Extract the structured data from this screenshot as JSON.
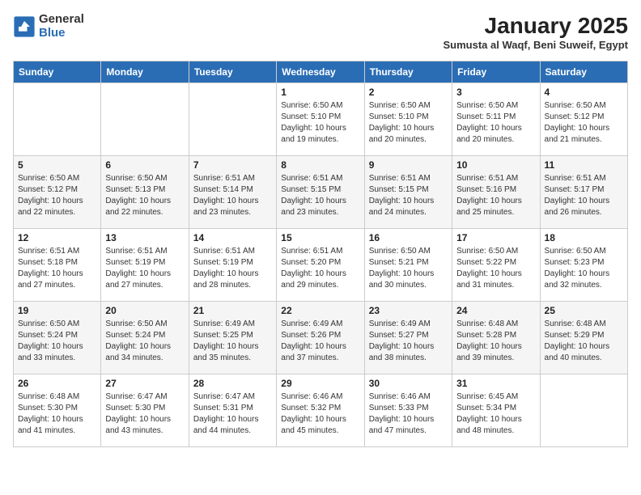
{
  "logo": {
    "general": "General",
    "blue": "Blue"
  },
  "title": "January 2025",
  "subtitle": "Sumusta al Waqf, Beni Suweif, Egypt",
  "headers": [
    "Sunday",
    "Monday",
    "Tuesday",
    "Wednesday",
    "Thursday",
    "Friday",
    "Saturday"
  ],
  "weeks": [
    [
      {
        "day": "",
        "info": ""
      },
      {
        "day": "",
        "info": ""
      },
      {
        "day": "",
        "info": ""
      },
      {
        "day": "1",
        "info": "Sunrise: 6:50 AM\nSunset: 5:10 PM\nDaylight: 10 hours\nand 19 minutes."
      },
      {
        "day": "2",
        "info": "Sunrise: 6:50 AM\nSunset: 5:10 PM\nDaylight: 10 hours\nand 20 minutes."
      },
      {
        "day": "3",
        "info": "Sunrise: 6:50 AM\nSunset: 5:11 PM\nDaylight: 10 hours\nand 20 minutes."
      },
      {
        "day": "4",
        "info": "Sunrise: 6:50 AM\nSunset: 5:12 PM\nDaylight: 10 hours\nand 21 minutes."
      }
    ],
    [
      {
        "day": "5",
        "info": "Sunrise: 6:50 AM\nSunset: 5:12 PM\nDaylight: 10 hours\nand 22 minutes."
      },
      {
        "day": "6",
        "info": "Sunrise: 6:50 AM\nSunset: 5:13 PM\nDaylight: 10 hours\nand 22 minutes."
      },
      {
        "day": "7",
        "info": "Sunrise: 6:51 AM\nSunset: 5:14 PM\nDaylight: 10 hours\nand 23 minutes."
      },
      {
        "day": "8",
        "info": "Sunrise: 6:51 AM\nSunset: 5:15 PM\nDaylight: 10 hours\nand 23 minutes."
      },
      {
        "day": "9",
        "info": "Sunrise: 6:51 AM\nSunset: 5:15 PM\nDaylight: 10 hours\nand 24 minutes."
      },
      {
        "day": "10",
        "info": "Sunrise: 6:51 AM\nSunset: 5:16 PM\nDaylight: 10 hours\nand 25 minutes."
      },
      {
        "day": "11",
        "info": "Sunrise: 6:51 AM\nSunset: 5:17 PM\nDaylight: 10 hours\nand 26 minutes."
      }
    ],
    [
      {
        "day": "12",
        "info": "Sunrise: 6:51 AM\nSunset: 5:18 PM\nDaylight: 10 hours\nand 27 minutes."
      },
      {
        "day": "13",
        "info": "Sunrise: 6:51 AM\nSunset: 5:19 PM\nDaylight: 10 hours\nand 27 minutes."
      },
      {
        "day": "14",
        "info": "Sunrise: 6:51 AM\nSunset: 5:19 PM\nDaylight: 10 hours\nand 28 minutes."
      },
      {
        "day": "15",
        "info": "Sunrise: 6:51 AM\nSunset: 5:20 PM\nDaylight: 10 hours\nand 29 minutes."
      },
      {
        "day": "16",
        "info": "Sunrise: 6:50 AM\nSunset: 5:21 PM\nDaylight: 10 hours\nand 30 minutes."
      },
      {
        "day": "17",
        "info": "Sunrise: 6:50 AM\nSunset: 5:22 PM\nDaylight: 10 hours\nand 31 minutes."
      },
      {
        "day": "18",
        "info": "Sunrise: 6:50 AM\nSunset: 5:23 PM\nDaylight: 10 hours\nand 32 minutes."
      }
    ],
    [
      {
        "day": "19",
        "info": "Sunrise: 6:50 AM\nSunset: 5:24 PM\nDaylight: 10 hours\nand 33 minutes."
      },
      {
        "day": "20",
        "info": "Sunrise: 6:50 AM\nSunset: 5:24 PM\nDaylight: 10 hours\nand 34 minutes."
      },
      {
        "day": "21",
        "info": "Sunrise: 6:49 AM\nSunset: 5:25 PM\nDaylight: 10 hours\nand 35 minutes."
      },
      {
        "day": "22",
        "info": "Sunrise: 6:49 AM\nSunset: 5:26 PM\nDaylight: 10 hours\nand 37 minutes."
      },
      {
        "day": "23",
        "info": "Sunrise: 6:49 AM\nSunset: 5:27 PM\nDaylight: 10 hours\nand 38 minutes."
      },
      {
        "day": "24",
        "info": "Sunrise: 6:48 AM\nSunset: 5:28 PM\nDaylight: 10 hours\nand 39 minutes."
      },
      {
        "day": "25",
        "info": "Sunrise: 6:48 AM\nSunset: 5:29 PM\nDaylight: 10 hours\nand 40 minutes."
      }
    ],
    [
      {
        "day": "26",
        "info": "Sunrise: 6:48 AM\nSunset: 5:30 PM\nDaylight: 10 hours\nand 41 minutes."
      },
      {
        "day": "27",
        "info": "Sunrise: 6:47 AM\nSunset: 5:30 PM\nDaylight: 10 hours\nand 43 minutes."
      },
      {
        "day": "28",
        "info": "Sunrise: 6:47 AM\nSunset: 5:31 PM\nDaylight: 10 hours\nand 44 minutes."
      },
      {
        "day": "29",
        "info": "Sunrise: 6:46 AM\nSunset: 5:32 PM\nDaylight: 10 hours\nand 45 minutes."
      },
      {
        "day": "30",
        "info": "Sunrise: 6:46 AM\nSunset: 5:33 PM\nDaylight: 10 hours\nand 47 minutes."
      },
      {
        "day": "31",
        "info": "Sunrise: 6:45 AM\nSunset: 5:34 PM\nDaylight: 10 hours\nand 48 minutes."
      },
      {
        "day": "",
        "info": ""
      }
    ]
  ]
}
